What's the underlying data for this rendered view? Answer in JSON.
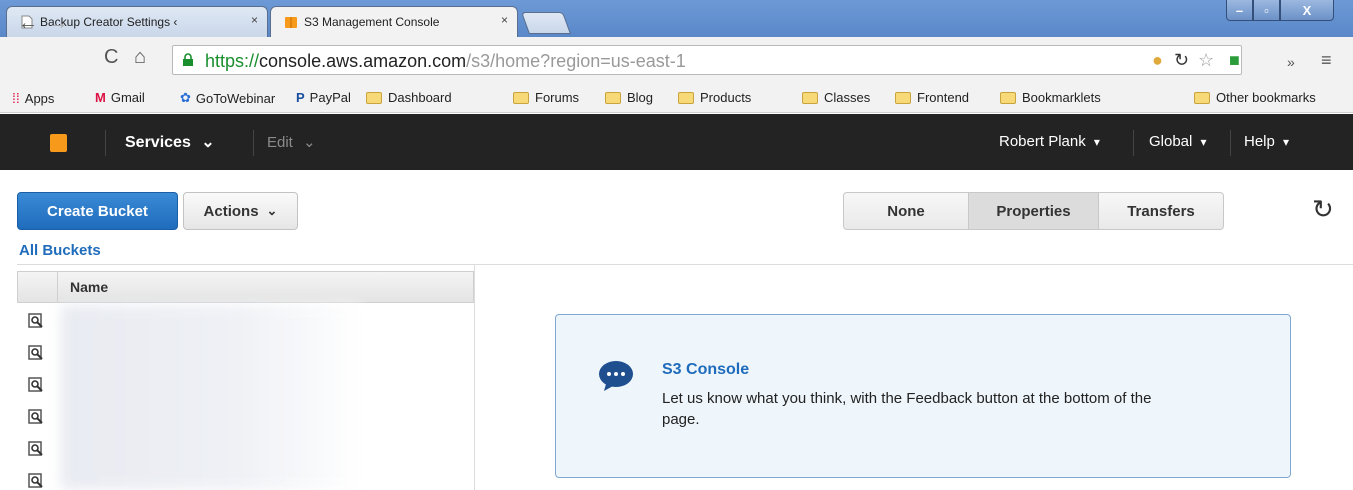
{
  "browser": {
    "tabs": [
      {
        "title": "Backup Creator Settings ‹",
        "active": false
      },
      {
        "title": "S3 Management Console",
        "active": true
      }
    ],
    "tab_close": "×",
    "window": {
      "minimize": "–",
      "maximize": "▫",
      "close": "X"
    },
    "url": {
      "scheme": "https://",
      "host": "console.aws.amazon.com",
      "path": "/s3/home?region=us-east-1"
    },
    "bookmarks": [
      "Apps",
      "Gmail",
      "GoToWebinar",
      "PayPal",
      "Dashboard",
      "Forums",
      "Blog",
      "Products",
      "Classes",
      "Frontend",
      "Bookmarklets"
    ],
    "other_bookmarks": "Other bookmarks"
  },
  "aws_nav": {
    "services": "Services",
    "edit": "Edit",
    "user": "Robert Plank",
    "region": "Global",
    "help": "Help",
    "caret": "▾"
  },
  "toolbar": {
    "create_bucket": "Create Bucket",
    "actions": "Actions",
    "segments": [
      "None",
      "Properties",
      "Transfers"
    ],
    "selected_segment": "Properties"
  },
  "list": {
    "breadcrumb": "All Buckets",
    "column_name": "Name",
    "row_count_visible": 6
  },
  "info": {
    "title": "S3 Console",
    "text": "Let us know what you think, with the Feedback button at the bottom of the page."
  },
  "colors": {
    "accent": "#1f6cbc",
    "nav_bg": "#232323",
    "aws_orange": "#f79a1b"
  }
}
